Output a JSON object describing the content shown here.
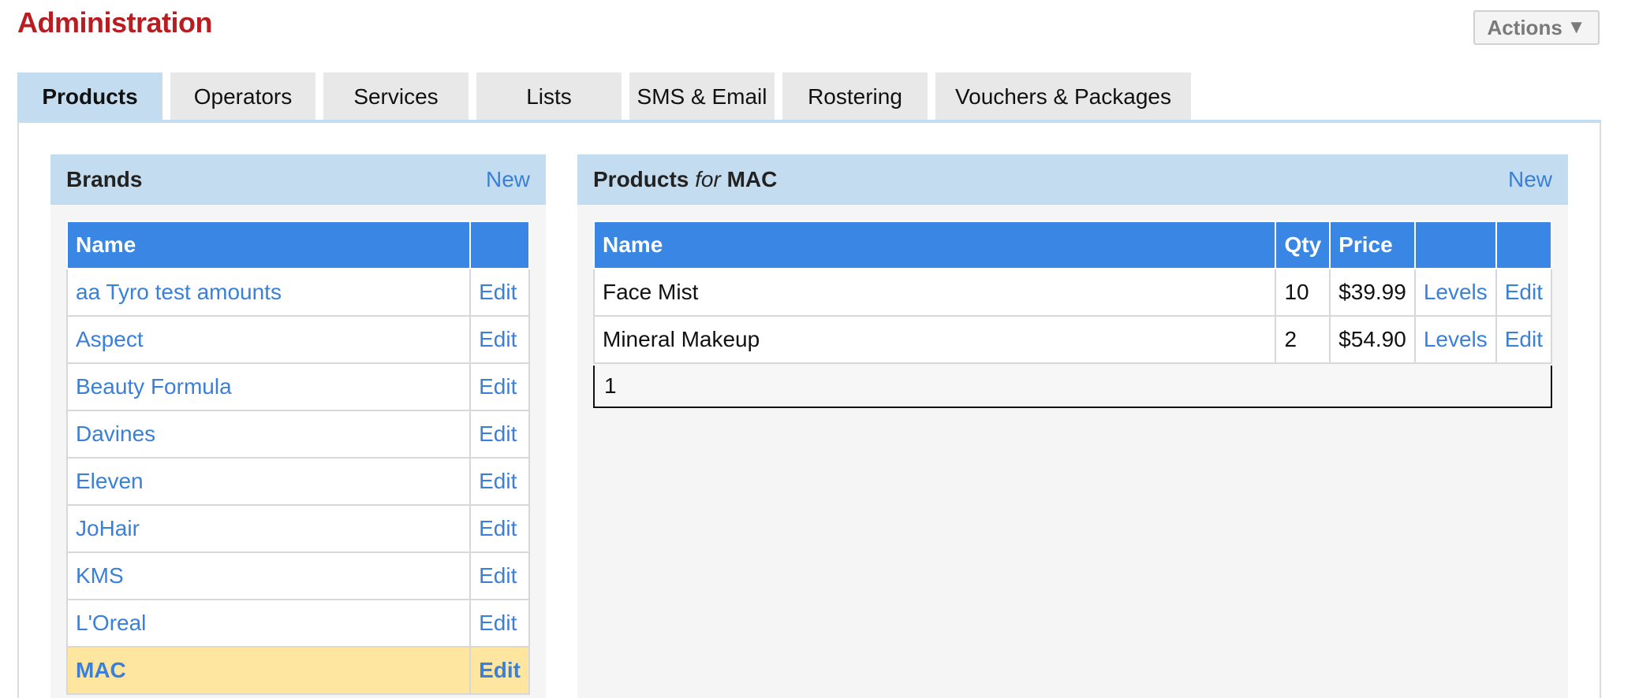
{
  "page": {
    "title": "Administration",
    "actions_label": "Actions",
    "actions_caret": "▼"
  },
  "tabs": [
    {
      "label": "Products",
      "active": true
    },
    {
      "label": "Operators",
      "active": false
    },
    {
      "label": "Services",
      "active": false
    },
    {
      "label": "Lists",
      "active": false
    },
    {
      "label": "SMS & Email",
      "active": false
    },
    {
      "label": "Rostering",
      "active": false
    },
    {
      "label": "Vouchers & Packages",
      "active": false
    }
  ],
  "brands": {
    "header": "Brands",
    "new_label": "New",
    "column_name": "Name",
    "edit_label": "Edit",
    "selected": "MAC",
    "rows": [
      "aa Tyro test amounts",
      "Aspect",
      "Beauty Formula",
      "Davines",
      "Eleven",
      "JoHair",
      "KMS",
      "L'Oreal",
      "MAC"
    ]
  },
  "products": {
    "header_prefix": "Products",
    "header_for": "for",
    "header_brand": "MAC",
    "new_label": "New",
    "columns": {
      "name": "Name",
      "qty": "Qty",
      "price": "Price"
    },
    "levels_label": "Levels",
    "edit_label": "Edit",
    "rows": [
      {
        "name": "Face Mist",
        "qty": "10",
        "price": "$39.99"
      },
      {
        "name": "Mineral Makeup",
        "qty": "2",
        "price": "$54.90"
      }
    ],
    "pager": "1"
  },
  "colors": {
    "title_red": "#b81d22",
    "header_blue": "#3a86e4",
    "panel_blue": "#c4dcef",
    "link_blue": "#3a7fd8",
    "selected_row": "#ffe6a0"
  }
}
